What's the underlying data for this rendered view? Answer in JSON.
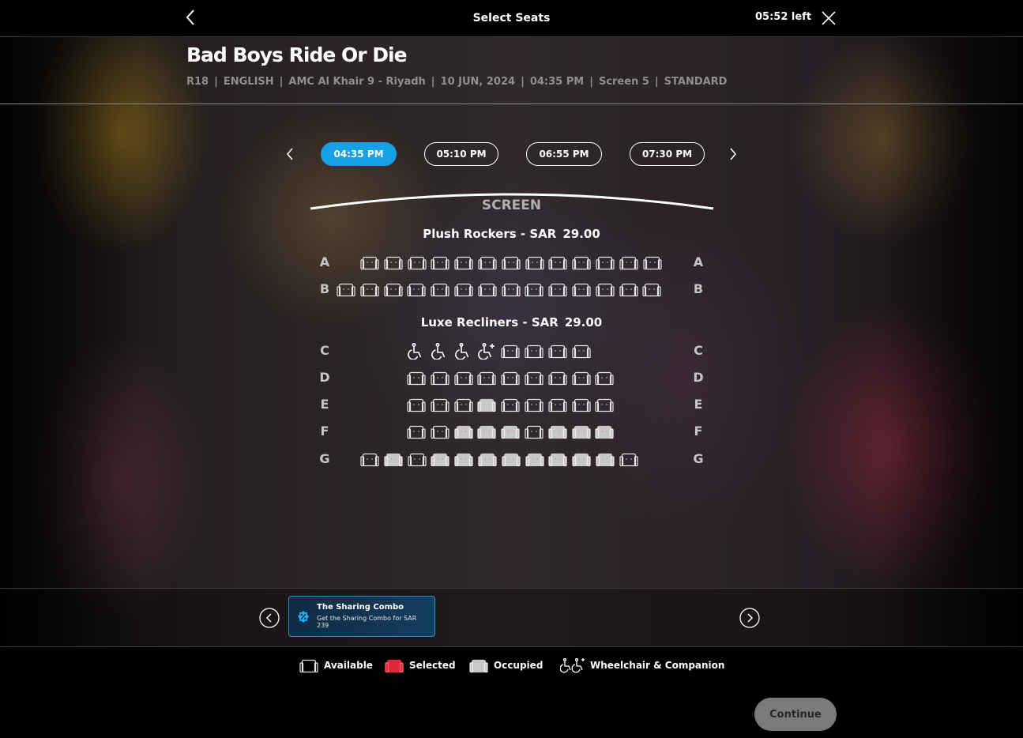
{
  "header": {
    "title": "Select Seats",
    "timer": "05:52 left",
    "back_icon": "chevron-left-icon",
    "close_icon": "close-icon"
  },
  "movie": {
    "title": "Bad Boys Ride Or Die",
    "meta": [
      "R18",
      "ENGLISH",
      "AMC Al Khair 9 - Riyadh",
      "10 JUN, 2024",
      "04:35 PM",
      "Screen 5",
      "STANDARD"
    ]
  },
  "showtimes": {
    "items": [
      "04:35 PM",
      "05:10 PM",
      "06:55 PM",
      "07:30 PM"
    ],
    "selected": "04:35 PM"
  },
  "screen_label": "SCREEN",
  "sections": [
    {
      "name": "Plush Rockers -",
      "currency": "SAR",
      "price": "29.00"
    },
    {
      "name": "Luxe Recliners -",
      "currency": "SAR",
      "price": "29.00"
    }
  ],
  "rows": [
    {
      "letter": "A",
      "seats": [
        "a",
        "a",
        "a",
        "a",
        "a",
        "a",
        "a",
        "a",
        "a",
        "a",
        "a",
        "a",
        "a"
      ]
    },
    {
      "letter": "B",
      "seats": [
        "a",
        "a",
        "a",
        "a",
        "a",
        "a",
        "a",
        "a",
        "a",
        "a",
        "a",
        "a",
        "a",
        "a"
      ]
    },
    {
      "letter": "C",
      "seats": [
        "w",
        "w",
        "w",
        "c",
        "a",
        "a",
        "a",
        "a"
      ]
    },
    {
      "letter": "D",
      "seats": [
        "a",
        "a",
        "a",
        "a",
        "a",
        "a",
        "a",
        "a",
        "a"
      ]
    },
    {
      "letter": "E",
      "seats": [
        "a",
        "a",
        "a",
        "o",
        "a",
        "a",
        "a",
        "a",
        "a"
      ]
    },
    {
      "letter": "F",
      "seats": [
        "a",
        "a",
        "o",
        "o",
        "o",
        "a",
        "o",
        "o",
        "o"
      ]
    },
    {
      "letter": "G",
      "seats": [
        "a",
        "o",
        "a",
        "o",
        "o",
        "o",
        "o",
        "o",
        "o",
        "o",
        "o",
        "a"
      ]
    }
  ],
  "offer": {
    "title": "The Sharing Combo",
    "description": "Get the Sharing Combo for SAR 239",
    "icon": "percent-icon"
  },
  "legend": {
    "available": "Available",
    "selected": "Selected",
    "occupied": "Occupied",
    "wheelchair": "Wheelchair & Companion"
  },
  "colors": {
    "accent": "#16a1e6",
    "selected": "#e0263a",
    "occupied": "#c8c8c8",
    "continue_bg": "#7a7a7a"
  },
  "continue_label": "Continue"
}
